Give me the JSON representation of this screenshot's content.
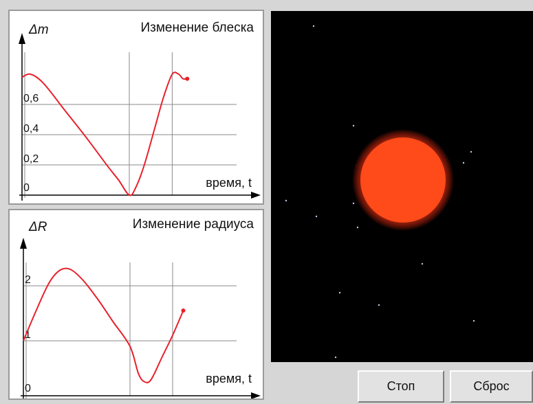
{
  "charts": [
    {
      "id": "brightness",
      "type": "line",
      "title": "Изменение блеска",
      "ylabel": "Δm",
      "xlabel": "время, t",
      "ylim": [
        0,
        0.8
      ],
      "ytick_labels": [
        "0,6",
        "0,4",
        "0,2",
        "0"
      ],
      "ytick_values": [
        0.6,
        0.4,
        0.2,
        0
      ],
      "x_grid_fraction": [
        0.5,
        0.7
      ],
      "x": [
        0,
        0.04,
        0.1,
        0.2,
        0.3,
        0.4,
        0.45,
        0.5,
        0.53,
        0.57,
        0.62,
        0.66,
        0.7,
        0.73,
        0.75,
        0.77
      ],
      "values": [
        0.78,
        0.8,
        0.74,
        0.56,
        0.38,
        0.19,
        0.1,
        0.0,
        0.05,
        0.2,
        0.45,
        0.65,
        0.8,
        0.8,
        0.77,
        0.77
      ],
      "line_color": "#e8202a"
    },
    {
      "id": "radius",
      "type": "line",
      "title": "Изменение радиуса",
      "ylabel": "ΔR",
      "xlabel": "время, t",
      "ylim": [
        0,
        2.6
      ],
      "ytick_labels": [
        "2",
        "1",
        "0"
      ],
      "ytick_values": [
        2,
        1,
        0
      ],
      "x_grid_fraction": [
        0.5,
        0.7
      ],
      "x": [
        0,
        0.06,
        0.12,
        0.17,
        0.22,
        0.28,
        0.35,
        0.42,
        0.5,
        0.54,
        0.57,
        0.6,
        0.65,
        0.7,
        0.75
      ],
      "values": [
        1.0,
        1.55,
        2.05,
        2.28,
        2.3,
        2.1,
        1.75,
        1.35,
        0.9,
        0.4,
        0.25,
        0.3,
        0.7,
        1.1,
        1.55
      ],
      "line_color": "#e8202a"
    }
  ],
  "star_view": {
    "background": "#000000",
    "star_core_color": "#ff4a1a",
    "star_glow_color": "#8a1a0a",
    "background_stars": [
      [
        62,
        22
      ],
      [
        120,
        167
      ],
      [
        291,
        205
      ],
      [
        280,
        221
      ],
      [
        124,
        225
      ],
      [
        22,
        276
      ],
      [
        120,
        280
      ],
      [
        66,
        299
      ],
      [
        126,
        315
      ],
      [
        220,
        368
      ],
      [
        100,
        410
      ],
      [
        157,
        428
      ],
      [
        295,
        451
      ],
      [
        94,
        504
      ]
    ]
  },
  "buttons": {
    "stop": "Стоп",
    "reset": "Сброс"
  },
  "colors": {
    "window_bg": "#d6d6d6",
    "grid": "#8a8a8a",
    "axis": "#000000",
    "curve": "#e8202a"
  }
}
